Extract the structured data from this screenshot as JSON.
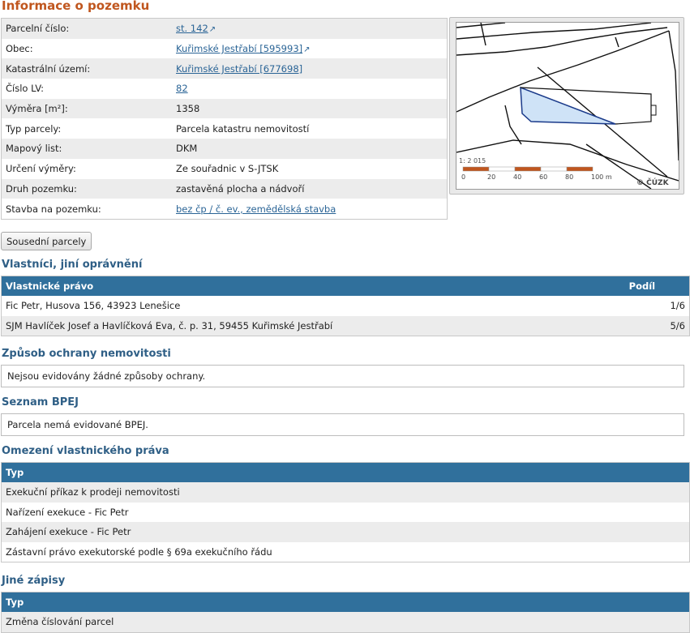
{
  "page_title": "Informace o pozemku",
  "info": {
    "rows": [
      {
        "label": "Parcelní číslo:",
        "value": "st. 142",
        "link": true,
        "ext": true
      },
      {
        "label": "Obec:",
        "value": "Kuřimské Jestřabí [595993]",
        "link": true,
        "ext": true
      },
      {
        "label": "Katastrální území:",
        "value": "Kuřimské Jestřabí [677698]",
        "link": true,
        "ext": false
      },
      {
        "label": "Číslo LV:",
        "value": "82",
        "link": true,
        "ext": false
      },
      {
        "label": "Výměra [m²]:",
        "value": "1358",
        "link": false,
        "ext": false
      },
      {
        "label": "Typ parcely:",
        "value": "Parcela katastru nemovitostí",
        "link": false,
        "ext": false
      },
      {
        "label": "Mapový list:",
        "value": "DKM",
        "link": false,
        "ext": false
      },
      {
        "label": "Určení výměry:",
        "value": "Ze souřadnic v S-JTSK",
        "link": false,
        "ext": false
      },
      {
        "label": "Druh pozemku:",
        "value": "zastavěná plocha a nádvoří",
        "link": false,
        "ext": false
      },
      {
        "label": "Stavba na pozemku:",
        "value": "bez čp / č. ev., zemědělská stavba",
        "link": true,
        "ext": false
      }
    ]
  },
  "map": {
    "scale_text": "1: 2 015",
    "scale_ticks": [
      "0",
      "20",
      "40",
      "60",
      "80",
      "100 m"
    ],
    "copyright": "© ČÚZK",
    "parcel_color": "#cfe3f7",
    "scale_color": "#c0561e"
  },
  "neighbors_button": "Sousední parcely",
  "ownership": {
    "title": "Vlastníci, jiní oprávnění",
    "headers": [
      "Vlastnické právo",
      "Podíl"
    ],
    "rows": [
      {
        "name": "Fic Petr, Husova 156, 43923 Lenešice",
        "share": "1/6"
      },
      {
        "name": "SJM Havlíček Josef a Havlíčková Eva, č. p. 31, 59455 Kuřimské Jestřabí",
        "share": "5/6"
      }
    ]
  },
  "protection": {
    "title": "Způsob ochrany nemovitosti",
    "text": "Nejsou evidovány žádné způsoby ochrany."
  },
  "bpej": {
    "title": "Seznam BPEJ",
    "text": "Parcela nemá evidované BPEJ."
  },
  "restrictions": {
    "title": "Omezení vlastnického práva",
    "header": "Typ",
    "rows": [
      "Exekuční příkaz k prodeji nemovitosti",
      "Nařízení exekuce - Fic Petr",
      "Zahájení exekuce - Fic Petr",
      "Zástavní právo exekutorské podle § 69a exekučního řádu"
    ]
  },
  "other": {
    "title": "Jiné zápisy",
    "header": "Typ",
    "rows": [
      "Změna číslování parcel"
    ]
  }
}
